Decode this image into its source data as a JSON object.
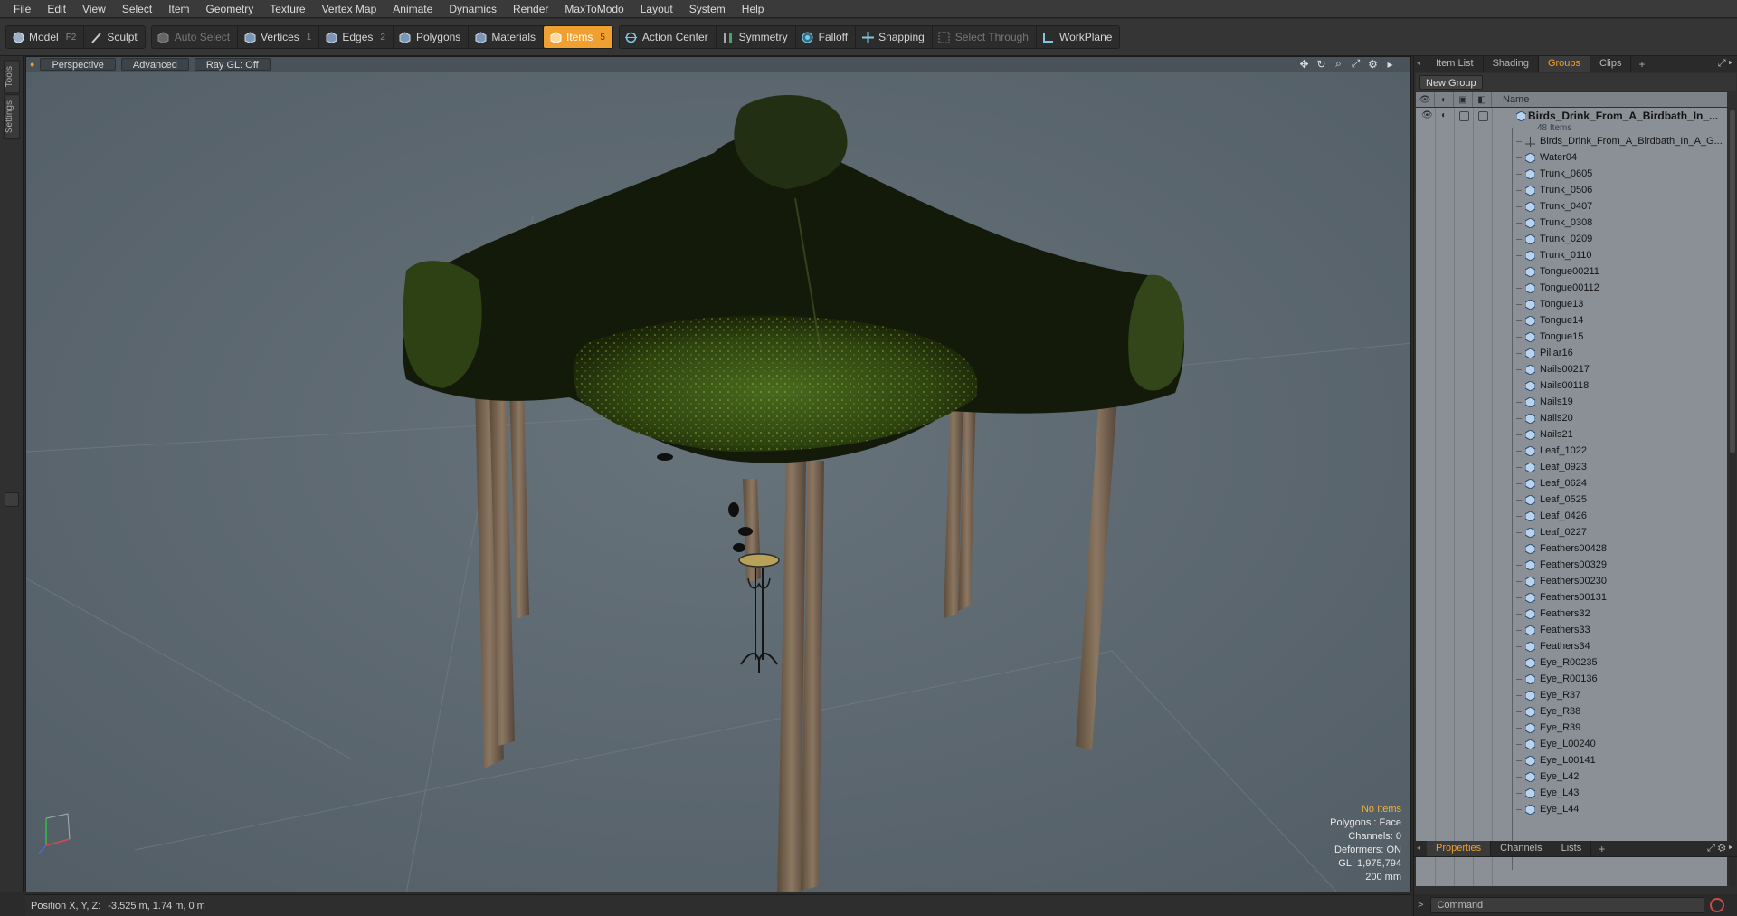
{
  "menu": [
    "File",
    "Edit",
    "View",
    "Select",
    "Item",
    "Geometry",
    "Texture",
    "Vertex Map",
    "Animate",
    "Dynamics",
    "Render",
    "MaxToModo",
    "Layout",
    "System",
    "Help"
  ],
  "toolbar": {
    "model": "Model",
    "model_key": "F2",
    "sculpt": "Sculpt",
    "auto_select": "Auto Select",
    "vertices": "Vertices",
    "vertices_key": "1",
    "edges": "Edges",
    "edges_key": "2",
    "polygons": "Polygons",
    "materials": "Materials",
    "items": "Items",
    "items_key": "5",
    "action_center": "Action Center",
    "symmetry": "Symmetry",
    "falloff": "Falloff",
    "snapping": "Snapping",
    "select_through": "Select Through",
    "workplane": "WorkPlane",
    "accent": "#f0a030"
  },
  "left_tabs": [
    "Tools",
    "Settings"
  ],
  "viewport": {
    "view": "Perspective",
    "advanced": "Advanced",
    "raygl": "Ray GL: Off",
    "info": {
      "items": "No Items",
      "polygons": "Polygons : Face",
      "channels": "Channels: 0",
      "deformers": "Deformers: ON",
      "gl": "GL: 1,975,794",
      "scale": "200 mm"
    }
  },
  "status": {
    "label": "Position X, Y, Z:",
    "value": "-3.525 m, 1.74 m, 0 m"
  },
  "panel": {
    "tabs": [
      "Item List",
      "Shading",
      "Groups",
      "Clips"
    ],
    "active_tab": "Groups",
    "new_group": "New Group",
    "column_name": "Name",
    "root_name": "Birds_Drink_From_A_Birdbath_In_...",
    "root_count": "48 Items",
    "items": [
      "Birds_Drink_From_A_Birdbath_In_A_G...",
      "Water04",
      "Trunk_0605",
      "Trunk_0506",
      "Trunk_0407",
      "Trunk_0308",
      "Trunk_0209",
      "Trunk_0110",
      "Tongue00211",
      "Tongue00112",
      "Tongue13",
      "Tongue14",
      "Tongue15",
      "Pillar16",
      "Nails00217",
      "Nails00118",
      "Nails19",
      "Nails20",
      "Nails21",
      "Leaf_1022",
      "Leaf_0923",
      "Leaf_0624",
      "Leaf_0525",
      "Leaf_0426",
      "Leaf_0227",
      "Feathers00428",
      "Feathers00329",
      "Feathers00230",
      "Feathers00131",
      "Feathers32",
      "Feathers33",
      "Feathers34",
      "Eye_R00235",
      "Eye_R00136",
      "Eye_R37",
      "Eye_R38",
      "Eye_R39",
      "Eye_L00240",
      "Eye_L00141",
      "Eye_L42",
      "Eye_L43",
      "Eye_L44"
    ],
    "bottom_tabs": [
      "Properties",
      "Channels",
      "Lists"
    ],
    "bottom_active": "Properties",
    "command_placeholder": "Command"
  }
}
